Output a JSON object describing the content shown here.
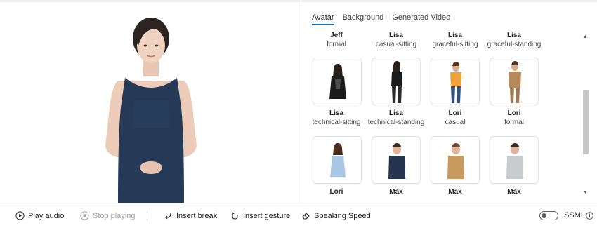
{
  "tabs": [
    {
      "label": "Avatar",
      "active": true
    },
    {
      "label": "Background",
      "active": false
    },
    {
      "label": "Generated Video",
      "active": false
    }
  ],
  "avatars": {
    "row1": [
      {
        "name": "Jeff",
        "style": "formal"
      },
      {
        "name": "Lisa",
        "style": "casual-sitting"
      },
      {
        "name": "Lisa",
        "style": "graceful-sitting"
      },
      {
        "name": "Lisa",
        "style": "graceful-standing"
      }
    ],
    "row2": [
      {
        "name": "Lisa",
        "style": "technical-sitting",
        "icon": "avatar-woman-black-outfit-sitting"
      },
      {
        "name": "Lisa",
        "style": "technical-standing",
        "icon": "avatar-woman-black-outfit-standing"
      },
      {
        "name": "Lori",
        "style": "casual",
        "icon": "avatar-woman-orange-top"
      },
      {
        "name": "Lori",
        "style": "formal",
        "icon": "avatar-woman-tan-suit"
      }
    ],
    "row3": [
      {
        "name": "Lori",
        "icon": "avatar-woman-blue-dress"
      },
      {
        "name": "Max",
        "icon": "avatar-man-navy-shirt"
      },
      {
        "name": "Max",
        "icon": "avatar-man-tan-sweater"
      },
      {
        "name": "Max",
        "icon": "avatar-man-gray-tshirt"
      }
    ]
  },
  "toolbar": {
    "play_audio": "Play audio",
    "stop_playing": "Stop playing",
    "insert_break": "Insert break",
    "insert_gesture": "Insert gesture",
    "speaking_speed": "Speaking Speed",
    "ssml_label": "SSML",
    "ssml_enabled": false
  },
  "colors": {
    "accent": "#0f6cbd",
    "dress": "#243a57"
  }
}
